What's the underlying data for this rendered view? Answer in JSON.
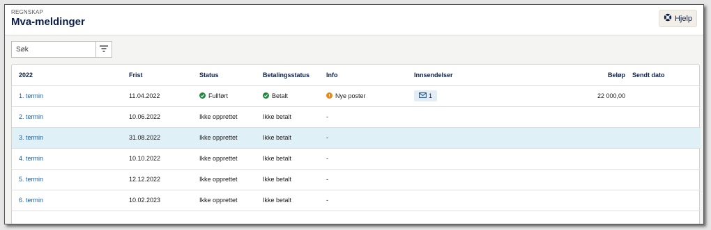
{
  "header": {
    "overline": "REGNSKAP",
    "title": "Mva-meldinger",
    "help_label": "Hjelp"
  },
  "toolbar": {
    "search_placeholder": "Søk"
  },
  "table": {
    "columns": [
      "2022",
      "Frist",
      "Status",
      "Betalingsstatus",
      "Info",
      "Innsendelser",
      "Beløp",
      "Sendt dato"
    ],
    "rows": [
      {
        "term": "1. termin",
        "frist": "11.04.2022",
        "status": "Fullført",
        "betaling": "Betalt",
        "info": "Nye poster",
        "innsendelser": "1",
        "belop": "22 000,00",
        "sendt": ""
      },
      {
        "term": "2. termin",
        "frist": "10.06.2022",
        "status": "Ikke opprettet",
        "betaling": "Ikke betalt",
        "info": "-",
        "innsendelser": "",
        "belop": "",
        "sendt": ""
      },
      {
        "term": "3. termin",
        "frist": "31.08.2022",
        "status": "Ikke opprettet",
        "betaling": "Ikke betalt",
        "info": "-",
        "innsendelser": "",
        "belop": "",
        "sendt": ""
      },
      {
        "term": "4. termin",
        "frist": "10.10.2022",
        "status": "Ikke opprettet",
        "betaling": "Ikke betalt",
        "info": "-",
        "innsendelser": "",
        "belop": "",
        "sendt": ""
      },
      {
        "term": "5. termin",
        "frist": "12.12.2022",
        "status": "Ikke opprettet",
        "betaling": "Ikke betalt",
        "info": "-",
        "innsendelser": "",
        "belop": "",
        "sendt": ""
      },
      {
        "term": "6. termin",
        "frist": "10.02.2023",
        "status": "Ikke opprettet",
        "betaling": "Ikke betalt",
        "info": "-",
        "innsendelser": "",
        "belop": "",
        "sendt": ""
      }
    ]
  },
  "colors": {
    "title": "#0b1f4b",
    "link": "#1e5b9c",
    "success": "#1f8a3b",
    "warning": "#e88a19",
    "selected_row": "#dff0f7"
  },
  "icons": {
    "help": "lifebuoy-icon",
    "filter": "filter-icon",
    "status_ok": "check-circle-icon",
    "info_warning": "alert-circle-icon",
    "submission": "envelope-icon"
  }
}
